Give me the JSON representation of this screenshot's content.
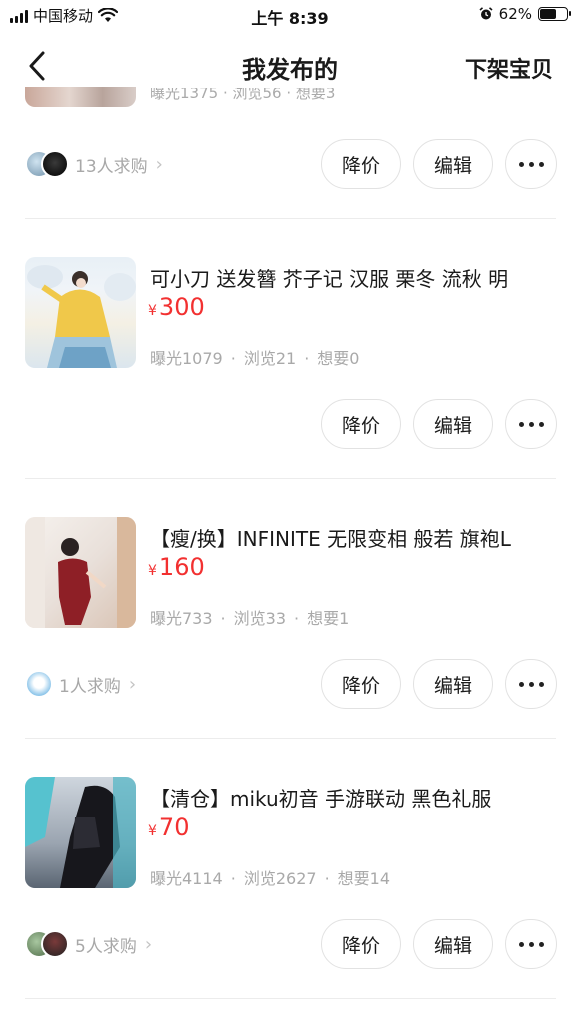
{
  "status_bar": {
    "carrier": "中国移动",
    "time": "上午 8:39",
    "battery": "62%",
    "battery_level": 0.62
  },
  "nav": {
    "title": "我发布的",
    "right_action": "下架宝贝"
  },
  "actions": {
    "reduce_price": "降价",
    "edit": "编辑"
  },
  "partial_item": {
    "stats": "曝光1375 · 浏览56 · 想要3",
    "buyers_text": "13人求购"
  },
  "items": [
    {
      "title": "可小刀 送发簪 芥子记 汉服 栗冬 流秋 明",
      "currency": "¥",
      "price": "300",
      "exposure": "曝光1079",
      "views": "浏览21",
      "wants": "想要0",
      "buyers_text": ""
    },
    {
      "title": "【瘦/换】INFINITE 无限变相 般若 旗袍L",
      "currency": "¥",
      "price": "160",
      "exposure": "曝光733",
      "views": "浏览33",
      "wants": "想要1",
      "buyers_text": "1人求购"
    },
    {
      "title": "【清仓】miku初音 手游联动 黑色礼服",
      "currency": "¥",
      "price": "70",
      "exposure": "曝光4114",
      "views": "浏览2627",
      "wants": "想要14",
      "buyers_text": "5人求购"
    }
  ],
  "separator": "·"
}
